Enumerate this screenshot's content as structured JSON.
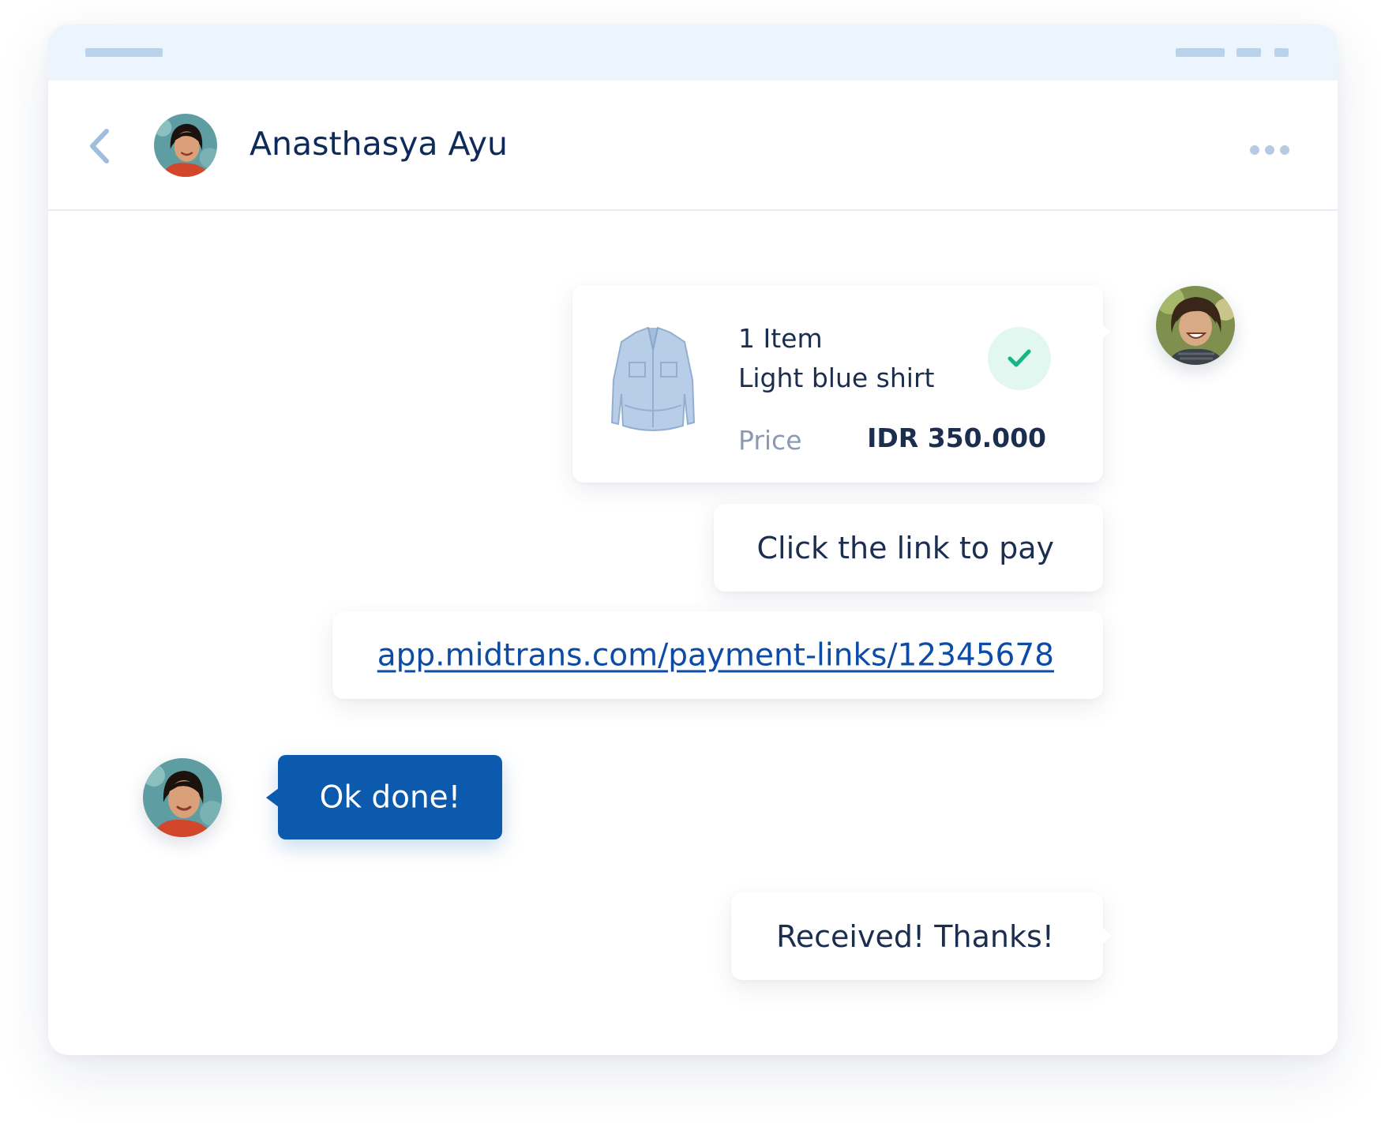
{
  "colors": {
    "accent": "#0b5aad",
    "link": "#0c4ba6",
    "text_primary": "#1c2e4f",
    "text_muted": "#8a9ab5",
    "titlebar_bg": "#ecf5fd",
    "success": "#15b58a",
    "success_bg": "#e1f7f0"
  },
  "header": {
    "contact_name": "Anasthasya Ayu",
    "back_icon": "chevron-left-icon",
    "more_icon": "more-horizontal-icon"
  },
  "messages": {
    "product_card": {
      "item_count": "1 Item",
      "item_name": "Light blue shirt",
      "price_label": "Price",
      "price_value": "IDR 350.000",
      "status_icon": "check-icon"
    },
    "pay_prompt": "Click the link to pay",
    "payment_link": "app.midtrans.com/payment-links/12345678",
    "customer_reply": "Ok done!",
    "merchant_reply": "Received! Thanks!"
  }
}
